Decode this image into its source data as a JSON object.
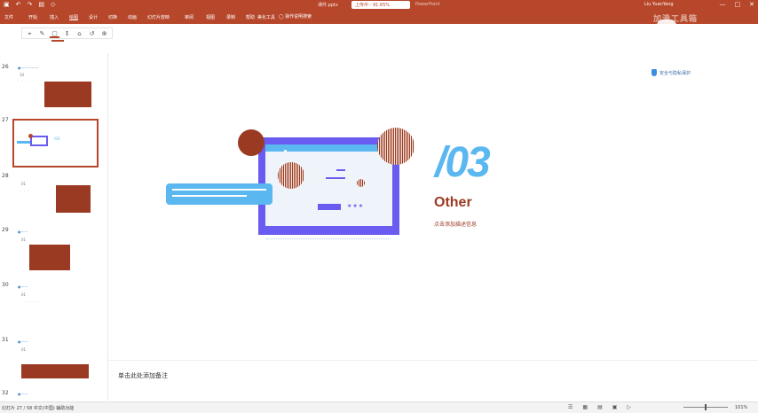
{
  "titlebar": {
    "quick_access": [
      "▣",
      "↶",
      "↷",
      "▤",
      "◇"
    ],
    "filename": "课件.pptx",
    "save_status": "上传中 - 91.65%",
    "extra": "PowerPoint",
    "user": "Liu YuanYang",
    "window_controls": [
      "—",
      "□",
      "✕"
    ]
  },
  "ribbon": {
    "tabs": [
      "文件",
      "开始",
      "插入",
      "绘图",
      "设计",
      "切换",
      "动画",
      "幻灯片放映",
      "审阅",
      "视图",
      "录制",
      "帮助",
      "美化工具"
    ],
    "active_tab": "绘图",
    "tell_me": "◯ 操作说明搜索",
    "brand": "加滑工具箱"
  },
  "draw_tools": [
    "⌖",
    "✎",
    "▢",
    "↕",
    "⌂",
    "↺",
    "⊕"
  ],
  "thumbnails": [
    {
      "num": "26",
      "sub": "10"
    },
    {
      "num": "27",
      "sub": ""
    },
    {
      "num": "28",
      "sub": "01"
    },
    {
      "num": "29",
      "sub": "01"
    },
    {
      "num": "30",
      "sub": "01"
    },
    {
      "num": "31",
      "sub": "01"
    },
    {
      "num": "32",
      "sub": ""
    }
  ],
  "slide": {
    "big_number": "/03",
    "heading": "Other",
    "description": "点击添加描述信息",
    "stars": "★★★",
    "security_label": "安全与隐私保护"
  },
  "notes": {
    "placeholder": "单击此处添加备注"
  },
  "statusbar": {
    "slide_info": "幻灯片 27 / 58  中文(中国)  辅助功能",
    "icons": [
      "☰",
      "▦",
      "▤",
      "▣",
      "▷"
    ],
    "zoom": "101%"
  },
  "colors": {
    "accent": "#b7472a",
    "brick": "#9b3a22",
    "sky": "#5ab7f0",
    "violet": "#6a5cf0"
  }
}
